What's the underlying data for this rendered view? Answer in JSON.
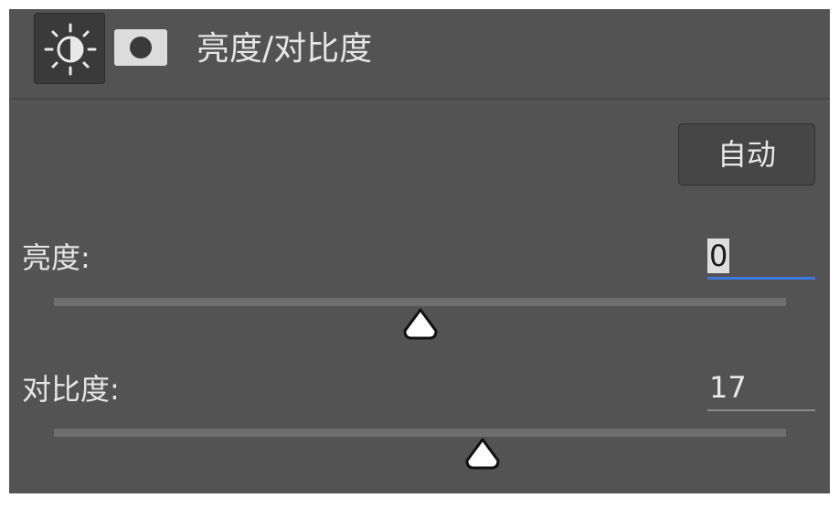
{
  "header": {
    "title": "亮度/对比度",
    "adjust_icon": "brightness-contrast-icon",
    "mask_icon": "layer-mask-icon"
  },
  "auto_button": {
    "label": "自动"
  },
  "brightness": {
    "label": "亮度:",
    "value": "0",
    "slider_fraction": 0.5
  },
  "contrast": {
    "label": "对比度:",
    "value": "17",
    "slider_fraction": 0.585
  },
  "colors": {
    "panel": "#535353",
    "focus_underline": "#3b7be0",
    "text": "#e6e6e6"
  }
}
